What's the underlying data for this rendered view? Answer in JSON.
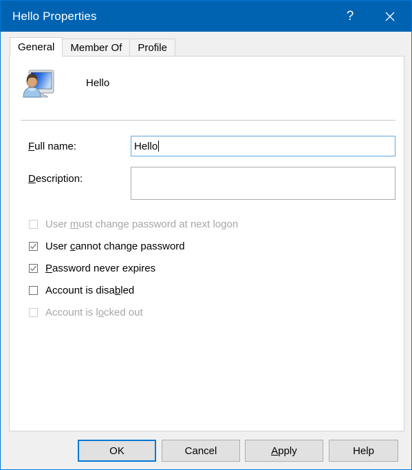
{
  "window": {
    "title": "Hello Properties",
    "accent_color": "#0063b1",
    "focus_color": "#0078d7"
  },
  "titlebar_buttons": [
    {
      "name": "help-button",
      "label": "?"
    },
    {
      "name": "close-button",
      "label": "✕"
    }
  ],
  "tabs": [
    {
      "label": "General",
      "active": true
    },
    {
      "label": "Member Of",
      "active": false
    },
    {
      "label": "Profile",
      "active": false
    }
  ],
  "identity": {
    "icon": "user-account-icon",
    "name": "Hello"
  },
  "fields": {
    "fullname": {
      "label_pre": "",
      "label_key": "F",
      "label_post": "ull name:",
      "value": "Hello",
      "focused": true
    },
    "description": {
      "label_pre": "",
      "label_key": "D",
      "label_post": "escription:",
      "value": "",
      "focused": false
    }
  },
  "checkboxes": [
    {
      "text_pre": "User ",
      "key": "m",
      "text_post": "ust change password at next logon",
      "checked": false,
      "disabled": true,
      "name": "checkbox-user-must-change-password"
    },
    {
      "text_pre": "User ",
      "key": "c",
      "text_post": "annot change password",
      "checked": true,
      "disabled": false,
      "name": "checkbox-user-cannot-change-password"
    },
    {
      "text_pre": "",
      "key": "P",
      "text_post": "assword never expires",
      "checked": true,
      "disabled": false,
      "name": "checkbox-password-never-expires"
    },
    {
      "text_pre": "Account is disa",
      "key": "b",
      "text_post": "led",
      "checked": false,
      "disabled": false,
      "name": "checkbox-account-is-disabled"
    },
    {
      "text_pre": "Account is l",
      "key": "o",
      "text_post": "cked out",
      "checked": false,
      "disabled": true,
      "name": "checkbox-account-is-locked-out"
    }
  ],
  "buttons": [
    {
      "label": "OK",
      "key": "",
      "default": true,
      "name": "ok-button"
    },
    {
      "label": "Cancel",
      "key": "",
      "default": false,
      "name": "cancel-button"
    },
    {
      "label_pre": "",
      "key": "A",
      "label_post": "pply",
      "default": false,
      "name": "apply-button"
    },
    {
      "label": "Help",
      "key": "",
      "default": false,
      "name": "help-button-footer"
    }
  ]
}
